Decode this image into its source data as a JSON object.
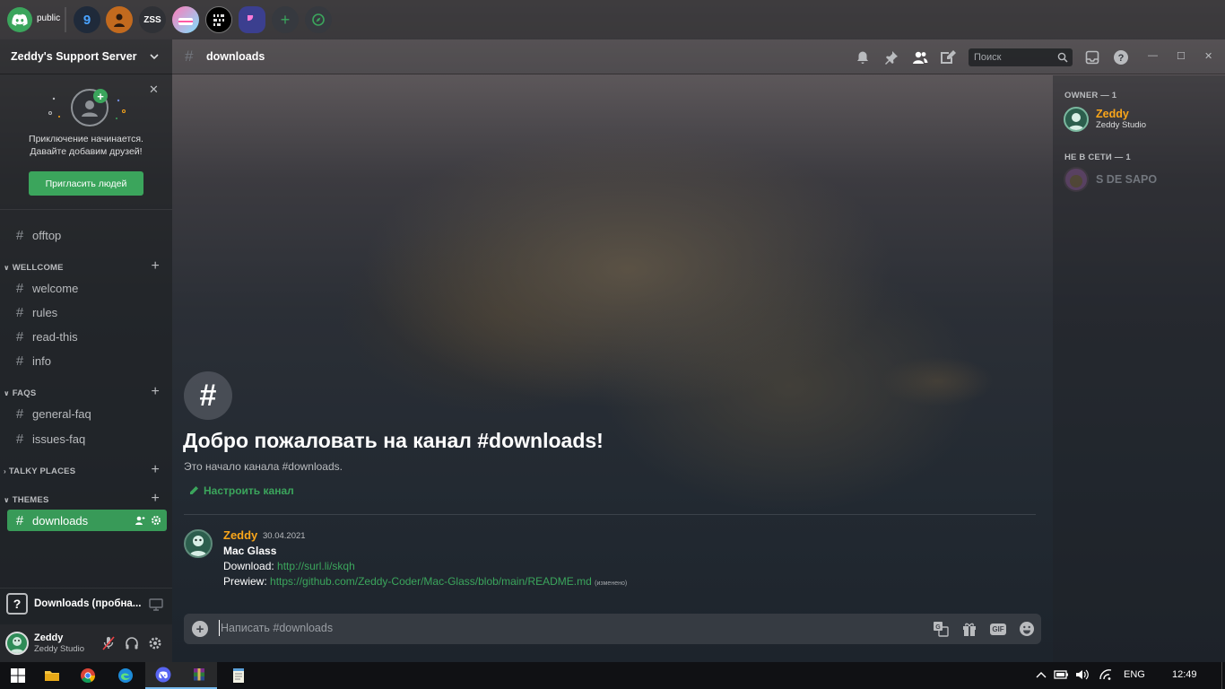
{
  "servers": {
    "home_label": "public",
    "items": [
      "9",
      "",
      "ZSS",
      "",
      "",
      "",
      "+",
      ""
    ]
  },
  "sidebar": {
    "server_name": "Zeddy's Support Server",
    "invite": {
      "line1": "Приключение начинается.",
      "line2": "Давайте добавим друзей!",
      "button": "Пригласить людей"
    },
    "top_channel": "offtop",
    "categories": [
      {
        "name": "WELLCOME",
        "channels": [
          "welcome",
          "rules",
          "read-this",
          "info"
        ]
      },
      {
        "name": "FAQS",
        "channels": [
          "general-faq",
          "issues-faq"
        ]
      },
      {
        "name": "TALKY PLACES",
        "channels": []
      },
      {
        "name": "THEMES",
        "channels": [
          "downloads"
        ]
      }
    ],
    "voice_channel": "Downloads (пробна...",
    "user": {
      "name": "Zeddy",
      "tag": "Zeddy Studio"
    }
  },
  "header": {
    "channel": "downloads",
    "search_placeholder": "Поиск"
  },
  "welcome": {
    "title": "Добро пожаловать на канал #downloads!",
    "subtitle": "Это начало канала #downloads.",
    "setup_link": "Настроить канал"
  },
  "message": {
    "author": "Zeddy",
    "timestamp": "30.04.2021",
    "line1": "Mac Glass",
    "line2_label": "Download: ",
    "line2_link": "http://surl.li/skqh",
    "line3_label": "Prewiew: ",
    "line3_link": "https://github.com/Zeddy-Coder/Mac-Glass/blob/main/README.md",
    "edited": "(изменено)"
  },
  "composer": {
    "placeholder": "Написать #downloads",
    "gif_label": "GIF"
  },
  "members": {
    "owner_header": "OWNER — 1",
    "owner": {
      "name": "Zeddy",
      "status": "Zeddy Studio"
    },
    "offline_header": "НЕ В СЕТИ — 1",
    "offline": {
      "name": "S DE SAPO"
    }
  },
  "taskbar": {
    "language": "ENG",
    "time": "12:49"
  },
  "colors": {
    "accent": "#3ba55c",
    "author": "#faa61a",
    "link": "#3ba55c",
    "owner_name": "#faa61a"
  }
}
